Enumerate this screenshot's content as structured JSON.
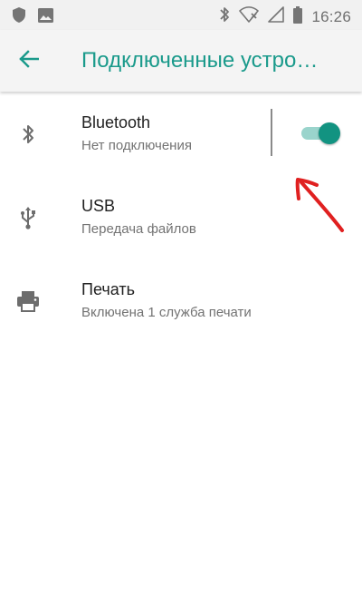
{
  "status_bar": {
    "time": "16:26",
    "left_icons": [
      "shield-icon",
      "image-icon"
    ],
    "right_icons": [
      "bluetooth-icon",
      "wifi-off-icon",
      "no-signal-icon",
      "battery-icon"
    ]
  },
  "app_bar": {
    "title": "Подключенные устро…",
    "back_icon": "arrow-left-icon"
  },
  "items": [
    {
      "title": "Bluetooth",
      "subtitle": "Нет подключения",
      "icon": "bluetooth-icon",
      "toggle_on": true
    },
    {
      "title": "USB",
      "subtitle": "Передача файлов",
      "icon": "usb-icon"
    },
    {
      "title": "Печать",
      "subtitle": "Включена 1 служба печати",
      "icon": "printer-icon"
    }
  ],
  "colors": {
    "accent": "#1a9a8b",
    "toggle_thumb": "#129381",
    "toggle_track": "#9ad4cc",
    "annotation": "#e02020"
  }
}
